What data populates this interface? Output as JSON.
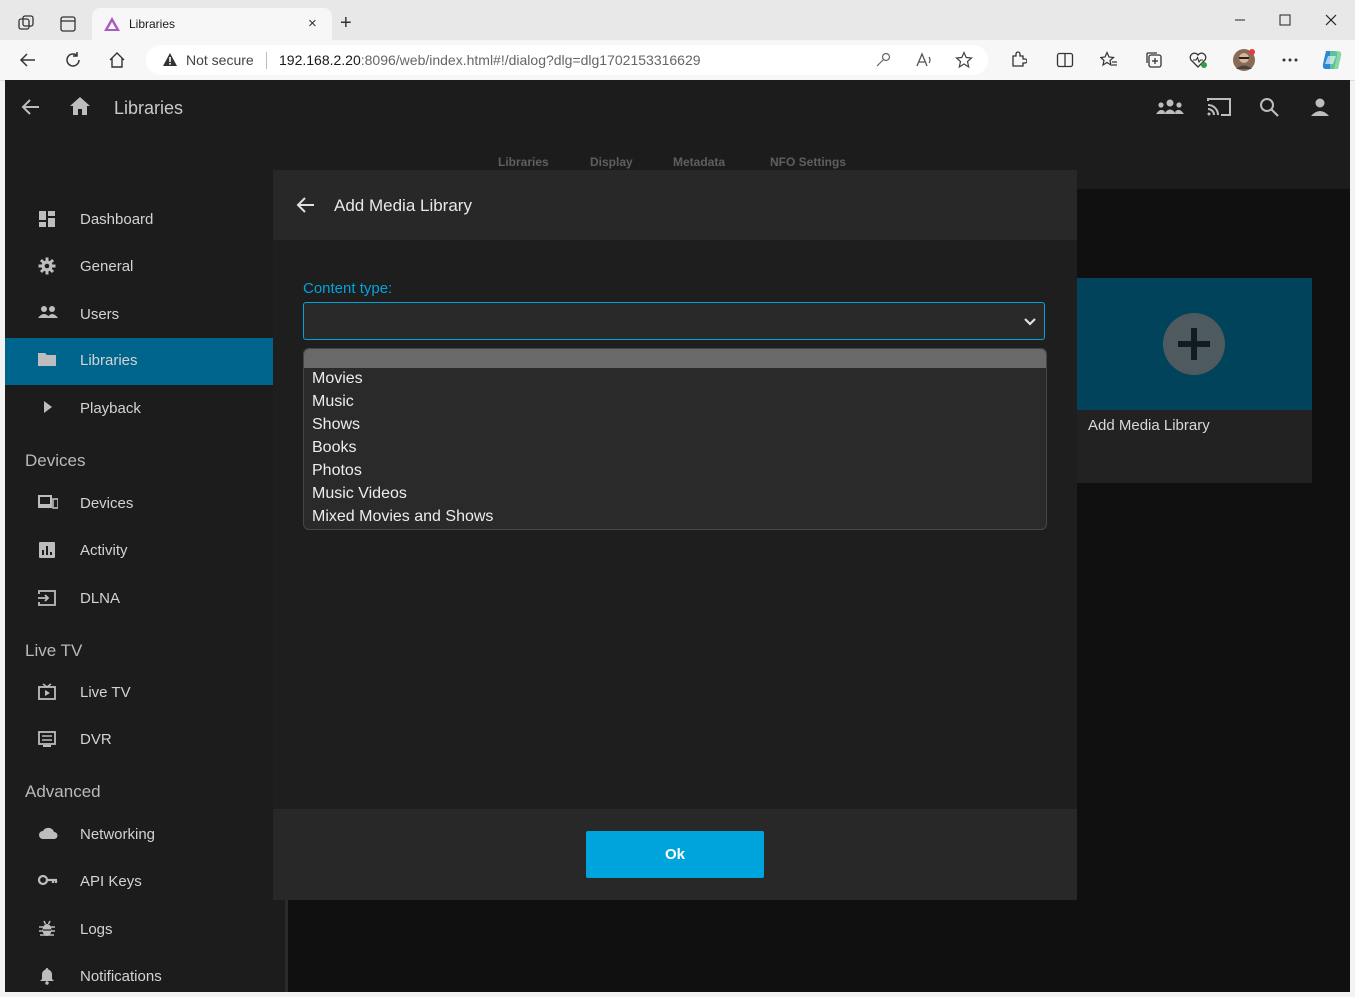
{
  "browser": {
    "tab_title": "Libraries",
    "tab_close": "×",
    "new_tab": "+",
    "security_label": "Not secure",
    "url_host": "192.168.2.20",
    "url_rest": ":8096/web/index.html#!/dialog?dlg=dlg1702153316629"
  },
  "header": {
    "title": "Libraries",
    "tabs": [
      "Libraries",
      "Display",
      "Metadata",
      "NFO Settings"
    ]
  },
  "sidebar": {
    "items": [
      {
        "label": "Dashboard",
        "icon": "dashboard-icon"
      },
      {
        "label": "General",
        "icon": "gear-icon"
      },
      {
        "label": "Users",
        "icon": "users-icon"
      },
      {
        "label": "Libraries",
        "icon": "folder-icon"
      },
      {
        "label": "Playback",
        "icon": "play-icon"
      }
    ],
    "sections": {
      "devices": {
        "title": "Devices",
        "items": [
          {
            "label": "Devices",
            "icon": "devices-icon"
          },
          {
            "label": "Activity",
            "icon": "activity-icon"
          },
          {
            "label": "DLNA",
            "icon": "dlna-icon"
          }
        ]
      },
      "livetv": {
        "title": "Live TV",
        "items": [
          {
            "label": "Live TV",
            "icon": "live-tv-icon"
          },
          {
            "label": "DVR",
            "icon": "dvr-icon"
          }
        ]
      },
      "advanced": {
        "title": "Advanced",
        "items": [
          {
            "label": "Networking",
            "icon": "cloud-icon"
          },
          {
            "label": "API Keys",
            "icon": "key-icon"
          },
          {
            "label": "Logs",
            "icon": "bug-icon"
          },
          {
            "label": "Notifications",
            "icon": "bell-icon"
          }
        ]
      }
    }
  },
  "add_card": {
    "label": "Add Media Library"
  },
  "dialog": {
    "title": "Add Media Library",
    "content_type_label": "Content type:",
    "options": [
      "Movies",
      "Music",
      "Shows",
      "Books",
      "Photos",
      "Music Videos",
      "Mixed Movies and Shows"
    ],
    "ok_label": "Ok"
  },
  "colors": {
    "accent": "#00a4dc",
    "active_nav": "#00658c",
    "background": "#101010"
  }
}
